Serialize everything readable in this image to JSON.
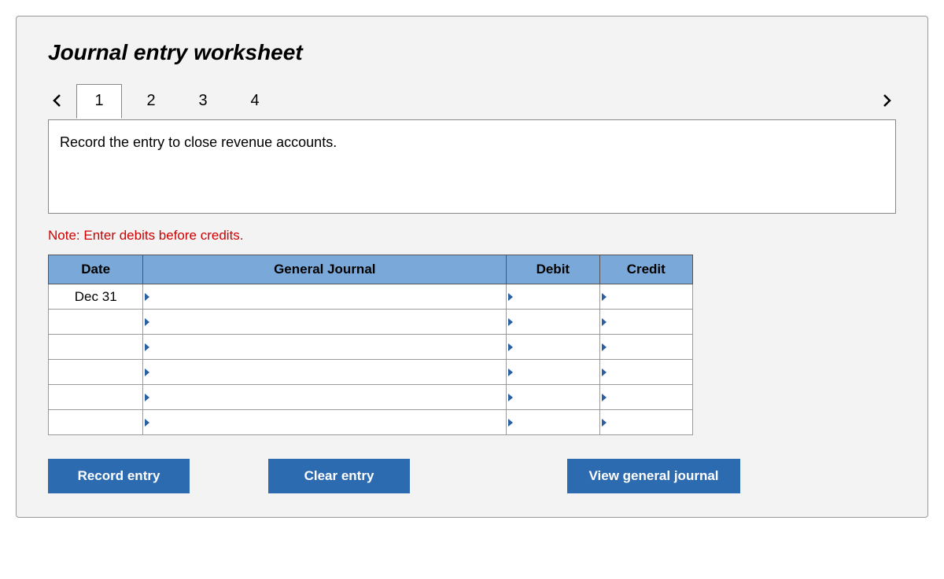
{
  "title": "Journal entry worksheet",
  "tabs": [
    "1",
    "2",
    "3",
    "4"
  ],
  "activeTab": 0,
  "instruction": "Record the entry to close revenue accounts.",
  "note": "Note: Enter debits before credits.",
  "table": {
    "headers": {
      "date": "Date",
      "general_journal": "General Journal",
      "debit": "Debit",
      "credit": "Credit"
    },
    "rows": [
      {
        "date": "Dec 31",
        "gj": "",
        "debit": "",
        "credit": ""
      },
      {
        "date": "",
        "gj": "",
        "debit": "",
        "credit": ""
      },
      {
        "date": "",
        "gj": "",
        "debit": "",
        "credit": ""
      },
      {
        "date": "",
        "gj": "",
        "debit": "",
        "credit": ""
      },
      {
        "date": "",
        "gj": "",
        "debit": "",
        "credit": ""
      },
      {
        "date": "",
        "gj": "",
        "debit": "",
        "credit": ""
      }
    ]
  },
  "buttons": {
    "record": "Record entry",
    "clear": "Clear entry",
    "view": "View general journal"
  }
}
